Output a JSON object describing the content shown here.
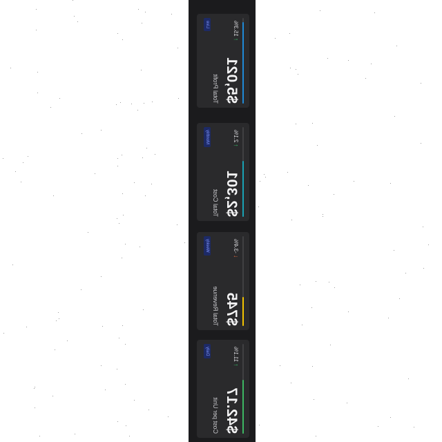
{
  "cards": [
    {
      "label": "Total Profit",
      "value": "$5,021",
      "change": "15.3%",
      "change_icon": "arrow-up-icon",
      "change_color": "#35c46a",
      "badge": "Live",
      "bar_color": "#1f8ad8",
      "bar_fraction": 0.95
    },
    {
      "label": "Total Cost",
      "value": "$2,301",
      "change": "2.1%",
      "change_icon": "arrow-up-icon",
      "change_color": "#35c46a",
      "badge": "Monthly",
      "bar_color": "#19a3b5",
      "bar_fraction": 0.62
    },
    {
      "label": "Total Revenue",
      "value": "$745",
      "change": "-3.4%",
      "change_icon": "arrow-down-icon",
      "change_color": "#e0683d",
      "badge": "Weekly",
      "bar_color": "#f4c400",
      "bar_fraction": 0.32
    },
    {
      "label": "Cost per Unit",
      "value": "$42.17",
      "change": "11.1%",
      "change_icon": "arrow-up-icon",
      "change_color": "#35c46a",
      "badge": "Daily",
      "bar_color": "#3db863",
      "bar_fraction": 0.6
    }
  ]
}
